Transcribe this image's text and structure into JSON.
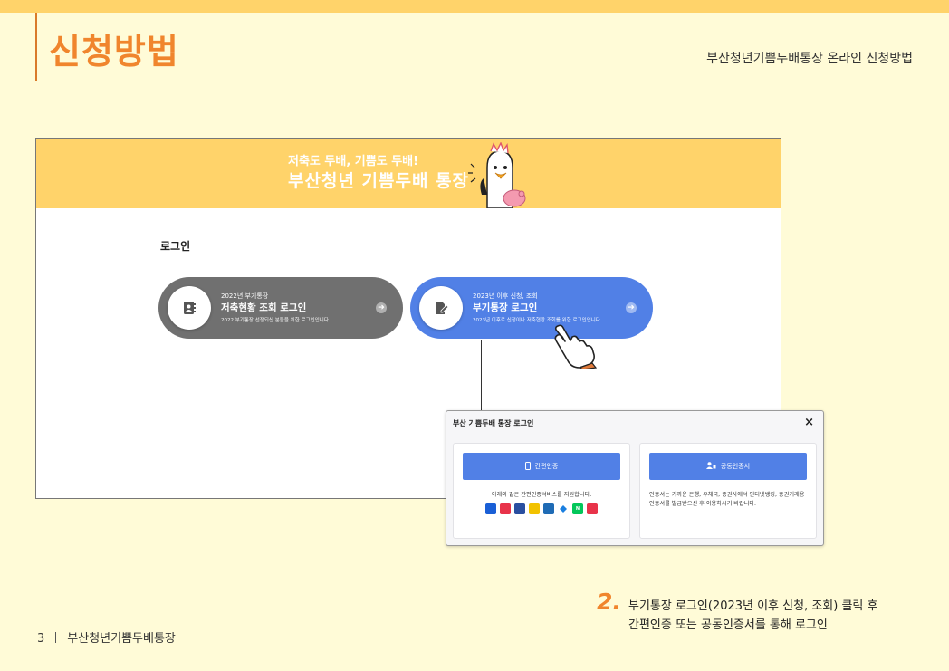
{
  "page": {
    "title": "신청방법",
    "subtitle": "부산청년기쁨두배통장 온라인 신청방법",
    "footer_page": "3",
    "footer_label": "부산청년기쁨두배통장"
  },
  "colors": {
    "accent": "#f0852d",
    "banner": "#ffd36a",
    "blue": "#5180e6",
    "gray": "#707070",
    "background": "#fffbd7"
  },
  "banner": {
    "small": "저축도 두배, 기쁨도 두배!",
    "big": "부산청년 기쁨두배 통장"
  },
  "login": {
    "label": "로그인",
    "options": [
      {
        "small": "2022년 부기통장",
        "big": "저축현황 조회 로그인",
        "desc": "2022 부기통장 선정되신 분들을 위한 로그인입니다.",
        "icon": "contact-book-icon"
      },
      {
        "small": "2023년 이후 신청, 조회",
        "big": "부기통장 로그인",
        "desc": "2023년 이후로 신청이나 저축현황 조회를 위한 로그인입니다.",
        "icon": "document-edit-icon"
      }
    ]
  },
  "modal": {
    "title": "부산 기쁨두배 통장 로그인",
    "close": "×",
    "simple_auth": {
      "button": "간편인증",
      "text": "아래와 같은 간편인증서비스를 지원합니다.",
      "services": [
        "kakao",
        "toss",
        "pass",
        "kb",
        "shinhan",
        "payco",
        "naver",
        "nh"
      ]
    },
    "joint_cert": {
      "button": "공동인증서",
      "text": "인증서는 가까운 은행, 우체국, 증권사에서 인터넷뱅킹, 증권거래용 인증서를 발급받으신 후 이용하시기 바랍니다."
    }
  },
  "step": {
    "number": "2.",
    "line1": "부기통장 로그인(2023년 이후 신청, 조회) 클릭 후",
    "line2": "간편인증 또는 공동인증서를 통해 로그인"
  }
}
